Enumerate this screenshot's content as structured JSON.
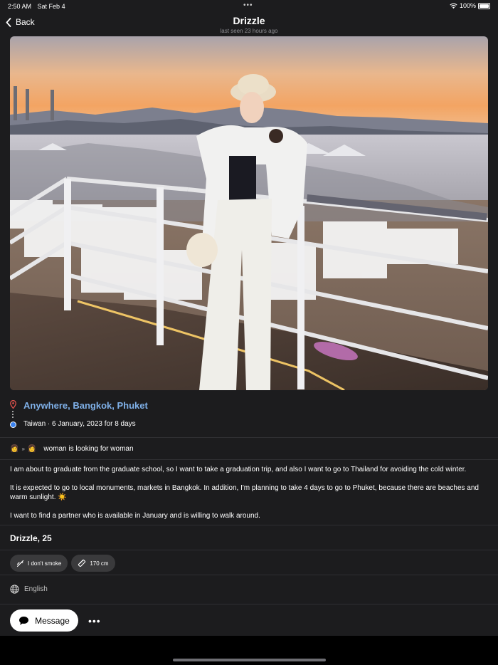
{
  "status_bar": {
    "time": "2:50 AM",
    "date": "Sat Feb 4",
    "battery": "100%"
  },
  "nav": {
    "back_label": "Back",
    "title": "Drizzle",
    "subtitle": "last seen 23 hours ago"
  },
  "trip": {
    "destination": "Anywhere, Bangkok, Phuket",
    "origin": "Taiwan · 6 January, 2023 for 8 days",
    "looking_for": "woman is looking for woman",
    "description": [
      "I am about to graduate from the graduate school, so I want to take a graduation trip, and also I want to go to Thailand for avoiding the cold winter.",
      "It is expected to go to local monuments, markets in Bangkok. In addition, I'm planning to take 4 days to go to Phuket, because there are beaches and warm sunlight.",
      "I want to find a partner who is available in January and is willing to walk around."
    ],
    "sun_emoji": "☀️"
  },
  "profile": {
    "name_age": "Drizzle, 25",
    "chips": [
      {
        "label": "I don't smoke",
        "icon": "no-smoking-icon"
      },
      {
        "label": "170 cm",
        "icon": "ruler-icon"
      }
    ],
    "language": "English"
  },
  "actions": {
    "message_label": "Message",
    "more_label": "•••"
  },
  "colors": {
    "background": "#1c1c1e",
    "accent_link": "#7fb0e8",
    "pin_red": "#e0524c",
    "origin_blue": "#3a82f0"
  }
}
